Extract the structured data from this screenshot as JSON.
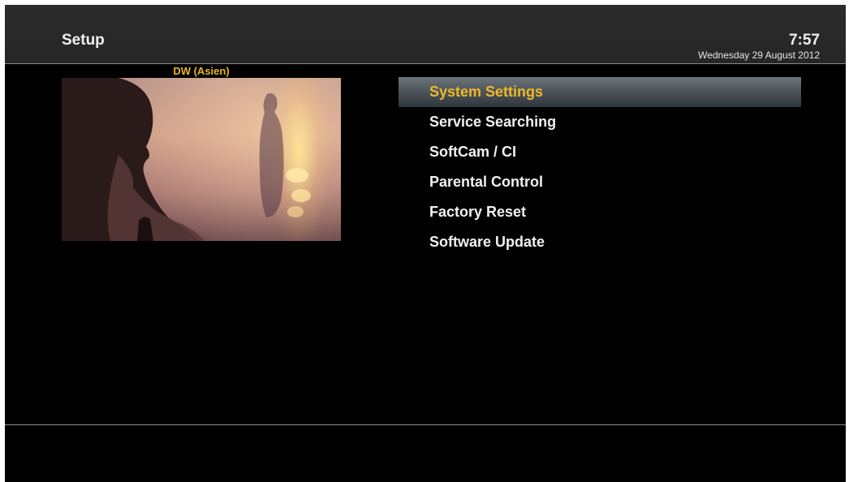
{
  "header": {
    "title": "Setup",
    "time": "7:57",
    "date": "Wednesday 29 August 2012"
  },
  "preview": {
    "channel": "DW (Asien)"
  },
  "menu": {
    "selected_index": 0,
    "items": [
      {
        "label": "System Settings"
      },
      {
        "label": "Service Searching"
      },
      {
        "label": "SoftCam / CI"
      },
      {
        "label": "Parental Control"
      },
      {
        "label": "Factory Reset"
      },
      {
        "label": "Software Update"
      }
    ]
  },
  "colors": {
    "background": "#000000",
    "header": "#2b2b2b",
    "selected_text": "#f0b828",
    "channel_label": "#e8b820",
    "text": "#f2f2f2"
  }
}
